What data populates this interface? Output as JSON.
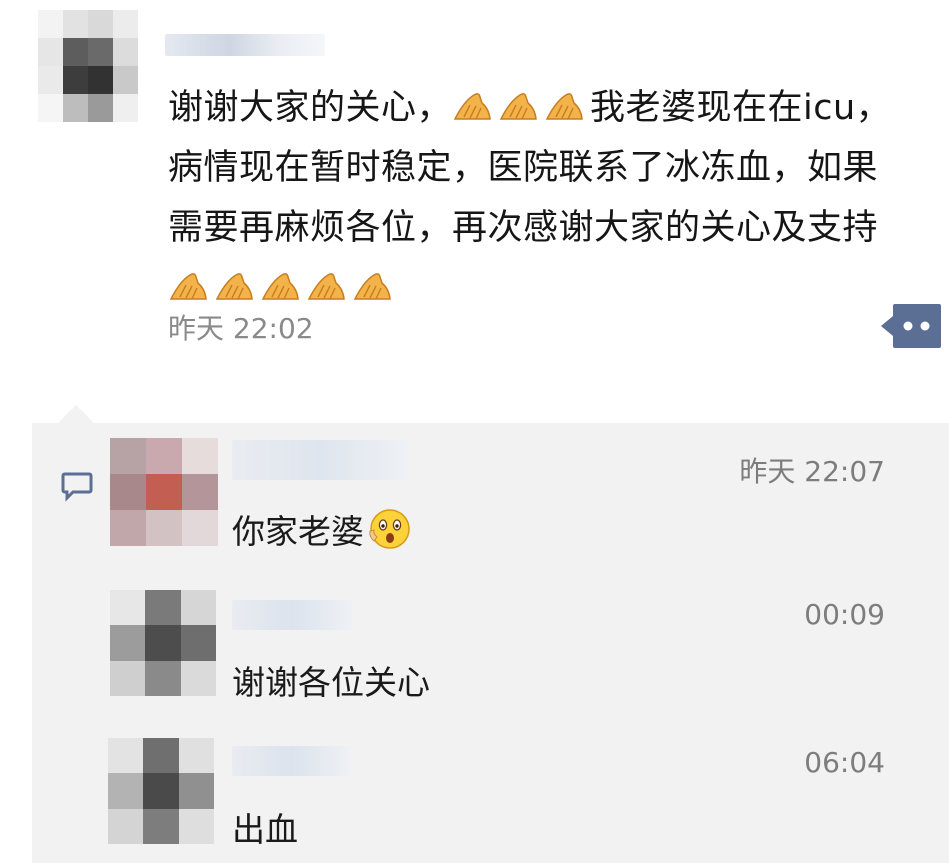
{
  "post": {
    "text_lines": [
      "谢谢大家的关心，",
      "我老婆现在在icu，",
      "病情现在暂时稳定，医院联系了冰冻血，如果",
      "需要再麻烦各位，再次感谢大家的关心及支持"
    ],
    "time": "昨天 22:02",
    "emoji_inline": "hands-icon",
    "emoji_trailing_count": 5
  },
  "comments": [
    {
      "text": "你家老婆",
      "time": "昨天 22:07",
      "emoji": "surprised-face-icon"
    },
    {
      "text": "谢谢各位关心",
      "time": "00:09"
    },
    {
      "text": "出血",
      "time": "06:04"
    }
  ],
  "colors": {
    "comment_bg": "#f2f2f2",
    "link_blue": "#576b95",
    "time_gray": "#8a8a8a"
  }
}
